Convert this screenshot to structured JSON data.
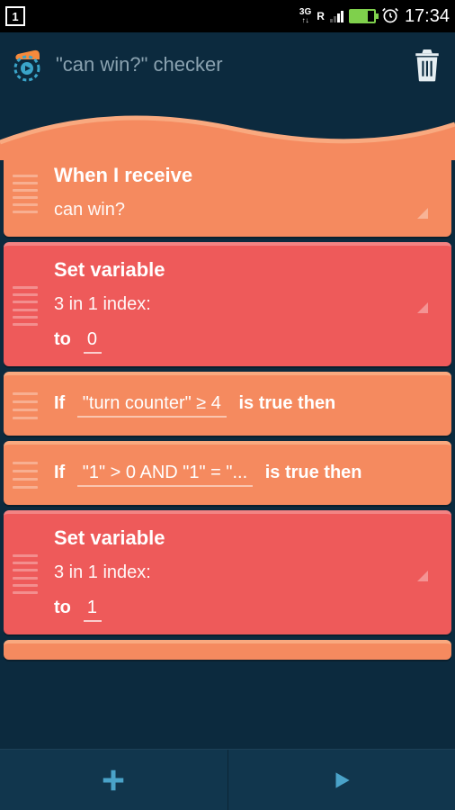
{
  "status": {
    "notification_count": "1",
    "network_label_top": "3G",
    "network_label_bottom": "↑↓",
    "roaming": "R",
    "time": "17:34"
  },
  "appbar": {
    "title": "\"can win?\" checker"
  },
  "blocks": {
    "when_receive": {
      "title": "When I receive",
      "message": "can win?"
    },
    "set_var_1": {
      "title": "Set variable",
      "variable": "3 in 1 index:",
      "to_label": "to",
      "value": "0"
    },
    "if_1": {
      "if_label": "If",
      "condition": "\"turn counter\" ≥ 4",
      "suffix": "is true then"
    },
    "if_2": {
      "if_label": "If",
      "condition": "\"1\" > 0 AND \"1\" = \"...",
      "suffix": "is true then"
    },
    "set_var_2": {
      "title": "Set variable",
      "variable": "3 in 1 index:",
      "to_label": "to",
      "value": "1"
    }
  }
}
